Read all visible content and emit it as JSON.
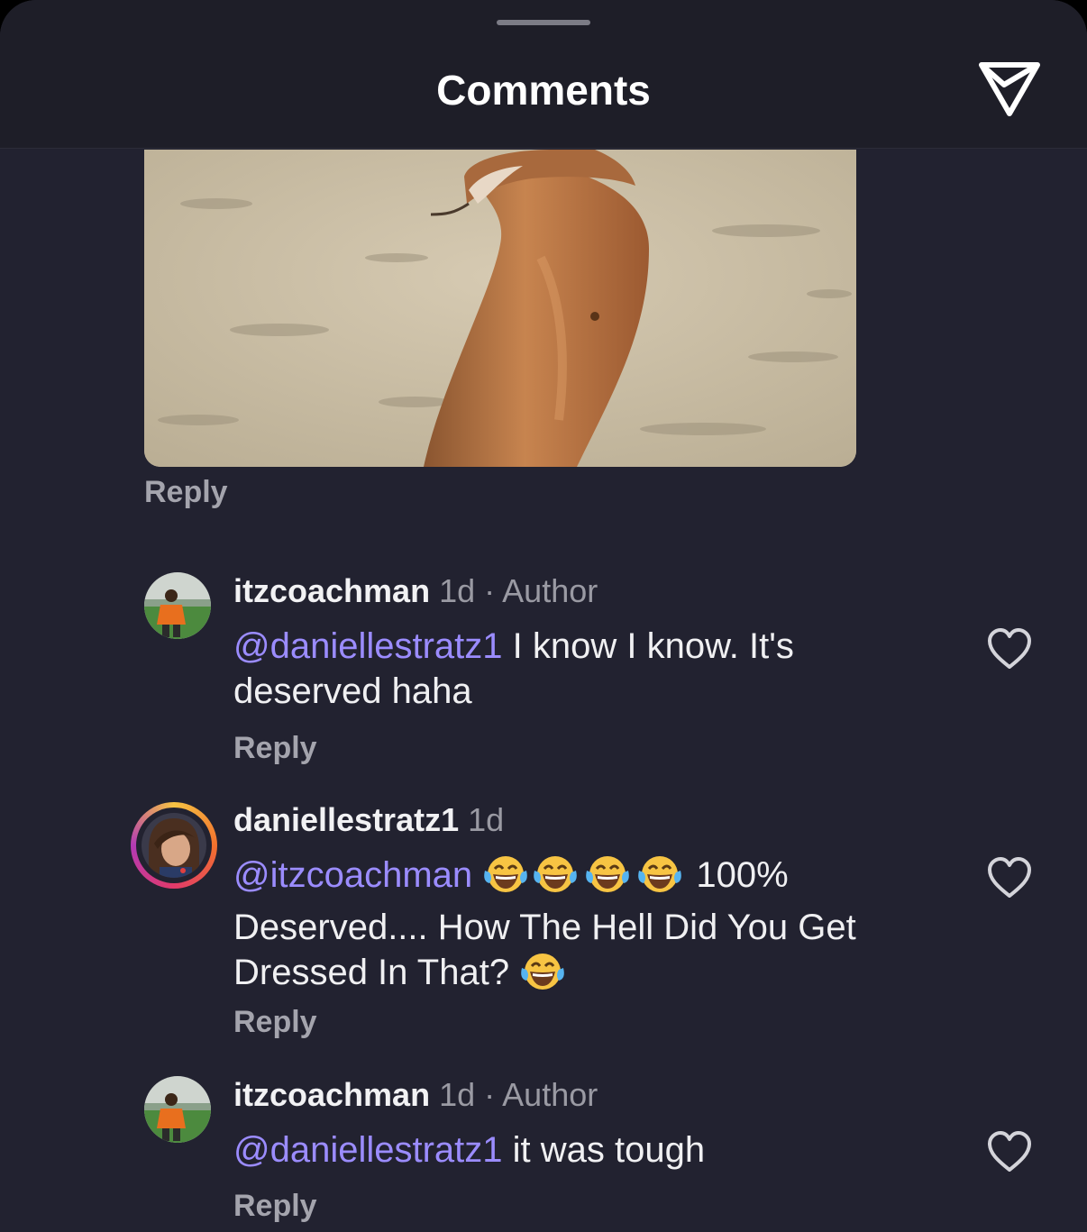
{
  "header": {
    "title": "Comments"
  },
  "comments_top": {
    "reply_label": "Reply"
  },
  "comments": [
    {
      "username": "itzcoachman",
      "time": "1d",
      "separator": "·",
      "badge": "Author",
      "mention": "@daniellestratz1",
      "text_line1": " I know I know. It's",
      "text_line2": "deserved haha",
      "reply_label": "Reply"
    },
    {
      "username": "daniellestratz1",
      "time": "1d",
      "mention": "@itzcoachman",
      "after_emojis": " 100%",
      "text_line2": "Deserved.... How The Hell Did You Get",
      "text_line3": "Dressed In That?",
      "reply_label": "Reply"
    },
    {
      "username": "itzcoachman",
      "time": "1d",
      "separator": "·",
      "badge": "Author",
      "mention": "@daniellestratz1",
      "text_line1": " it was tough",
      "reply_label": "Reply"
    }
  ],
  "icons": {
    "share": "send-icon",
    "like": "heart-icon",
    "emoji": "tears-of-joy-emoji"
  },
  "colors": {
    "background": "#222230",
    "mention": "#9b8cff",
    "secondary_text": "#9a9aa3"
  }
}
